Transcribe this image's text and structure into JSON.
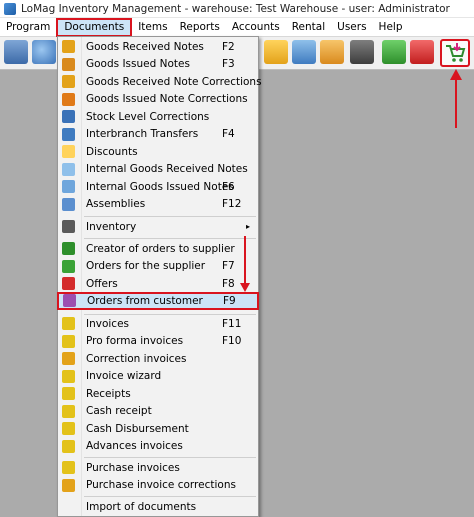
{
  "window": {
    "title": "LoMag Inventory Management - warehouse: Test Warehouse - user: Administrator"
  },
  "menubar": {
    "items": [
      "Program",
      "Documents",
      "Items",
      "Reports",
      "Accounts",
      "Rental",
      "Users",
      "Help"
    ]
  },
  "menu": {
    "items": [
      {
        "label": "Goods Received Notes",
        "shortcut": "F2"
      },
      {
        "label": "Goods Issued Notes",
        "shortcut": "F3"
      },
      {
        "label": "Goods Received Note Corrections",
        "shortcut": ""
      },
      {
        "label": "Goods Issued Note Corrections",
        "shortcut": ""
      },
      {
        "label": "Stock Level Corrections",
        "shortcut": ""
      },
      {
        "label": "Interbranch Transfers",
        "shortcut": "F4"
      },
      {
        "label": "Discounts",
        "shortcut": ""
      },
      {
        "label": "Internal Goods Received Notes",
        "shortcut": ""
      },
      {
        "label": "Internal Goods Issued Notes",
        "shortcut": "F6"
      },
      {
        "label": "Assemblies",
        "shortcut": "F12"
      },
      {
        "label": "Inventory",
        "shortcut": "",
        "submenu": "▸"
      },
      {
        "label": "Creator of orders to supplier",
        "shortcut": ""
      },
      {
        "label": "Orders for the supplier",
        "shortcut": "F7"
      },
      {
        "label": "Offers",
        "shortcut": "F8"
      },
      {
        "label": "Orders from customer",
        "shortcut": "F9"
      },
      {
        "label": "Invoices",
        "shortcut": "F11"
      },
      {
        "label": "Pro forma invoices",
        "shortcut": "F10"
      },
      {
        "label": "Correction invoices",
        "shortcut": ""
      },
      {
        "label": "Invoice wizard",
        "shortcut": ""
      },
      {
        "label": "Receipts",
        "shortcut": ""
      },
      {
        "label": "Cash receipt",
        "shortcut": ""
      },
      {
        "label": "Cash Disbursement",
        "shortcut": ""
      },
      {
        "label": "Advances invoices",
        "shortcut": ""
      },
      {
        "label": "Purchase invoices",
        "shortcut": ""
      },
      {
        "label": "Purchase invoice corrections",
        "shortcut": ""
      },
      {
        "label": "Import of documents",
        "shortcut": ""
      }
    ]
  },
  "colors": {
    "highlight": "#d9141f",
    "selection": "#cce4f7",
    "workspace": "#ababab"
  }
}
